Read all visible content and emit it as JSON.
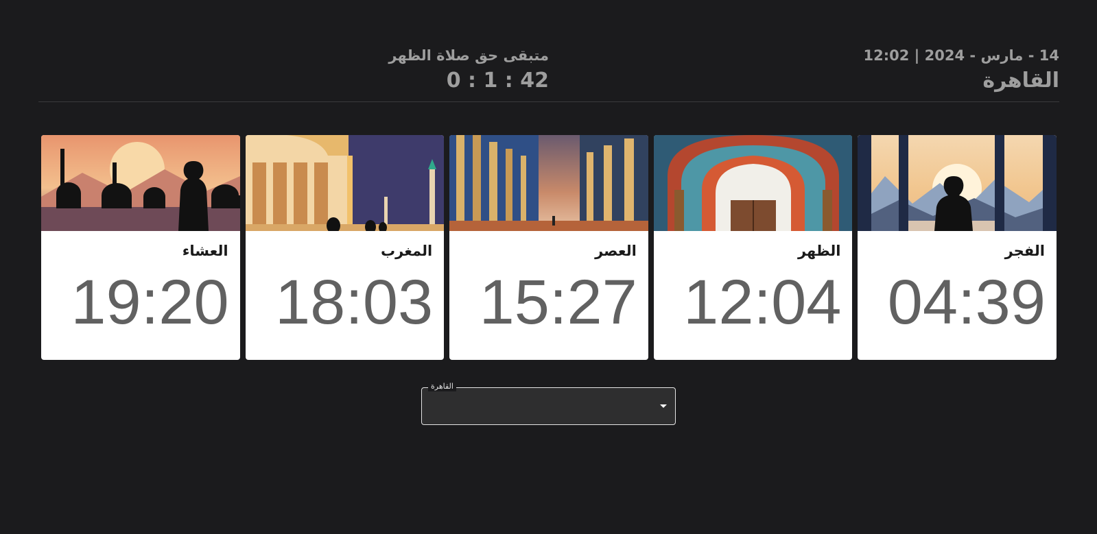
{
  "header": {
    "date_time": "14 - مارس - 2024 | 12:02",
    "city": "القاهرة",
    "remaining_label": "متبقى حق صلاة الظهر",
    "countdown": "0 : 1 : 42"
  },
  "prayers": [
    {
      "name": "الفجر",
      "time": "04:39",
      "image_icon": "dawn-silhouette-image"
    },
    {
      "name": "الظهر",
      "time": "12:04",
      "image_icon": "mosque-arch-image"
    },
    {
      "name": "العصر",
      "time": "15:27",
      "image_icon": "colonnade-sunset-image"
    },
    {
      "name": "المغرب",
      "time": "18:03",
      "image_icon": "mosque-dusk-image"
    },
    {
      "name": "العشاء",
      "time": "19:20",
      "image_icon": "mosque-skyline-image"
    }
  ],
  "city_select": {
    "label": "القاهرة",
    "value": ""
  },
  "colors": {
    "background": "#1b1b1d",
    "muted_text": "#9e9e9e",
    "card_bg": "#ffffff",
    "time_text": "#616161"
  }
}
